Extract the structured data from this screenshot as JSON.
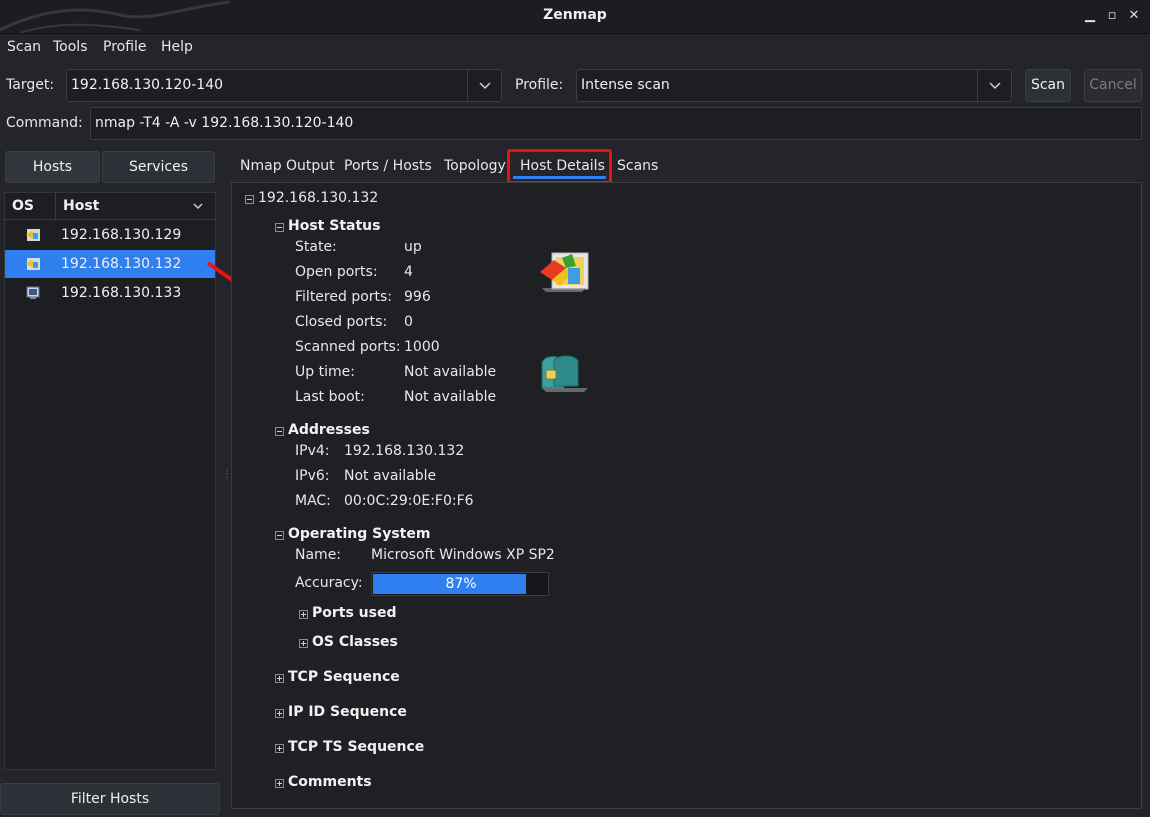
{
  "window": {
    "title": "Zenmap"
  },
  "menu": [
    "Scan",
    "Tools",
    "Profile",
    "Help"
  ],
  "toolbar": {
    "target_label": "Target:",
    "target_value": "192.168.130.120-140",
    "profile_label": "Profile:",
    "profile_value": "Intense scan",
    "scan_label": "Scan",
    "cancel_label": "Cancel",
    "command_label": "Command:",
    "command_value": "nmap -T4 -A -v 192.168.130.120-140"
  },
  "left": {
    "hosts_tab": "Hosts",
    "services_tab": "Services",
    "col_os": "OS",
    "col_host": "Host",
    "hosts": [
      "192.168.130.129",
      "192.168.130.132",
      "192.168.130.133"
    ],
    "selected_index": 1,
    "filter_label": "Filter Hosts"
  },
  "tabs": [
    "Nmap Output",
    "Ports / Hosts",
    "Topology",
    "Host Details",
    "Scans"
  ],
  "active_tab": "Host Details",
  "details": {
    "host": "192.168.130.132",
    "host_status": {
      "heading": "Host Status",
      "rows": [
        {
          "k": "State:",
          "v": "up"
        },
        {
          "k": "Open ports:",
          "v": "4"
        },
        {
          "k": "Filtered ports:",
          "v": "996"
        },
        {
          "k": "Closed ports:",
          "v": "0"
        },
        {
          "k": "Scanned ports:",
          "v": "1000"
        },
        {
          "k": "Up time:",
          "v": "Not available"
        },
        {
          "k": "Last boot:",
          "v": "Not available"
        }
      ]
    },
    "addresses": {
      "heading": "Addresses",
      "rows": [
        {
          "k": "IPv4:",
          "v": "192.168.130.132"
        },
        {
          "k": "IPv6:",
          "v": "Not available"
        },
        {
          "k": "MAC:",
          "v": "00:0C:29:0E:F0:F6"
        }
      ]
    },
    "os": {
      "heading": "Operating System",
      "name_label": "Name:",
      "name_value": "Microsoft Windows XP SP2",
      "accuracy_label": "Accuracy:",
      "accuracy_text": "87%",
      "accuracy_fraction": 0.87,
      "ports_used": "Ports used",
      "os_classes": "OS Classes"
    },
    "collapsed": [
      "TCP Sequence",
      "IP ID Sequence",
      "TCP TS Sequence",
      "Comments"
    ]
  },
  "colors": {
    "accent": "#2f7ff0",
    "highlight": "#ee1111",
    "arrow": "#ee1111"
  },
  "icons": [
    "windows-os-icon",
    "treasure-chest-icon",
    "chevron-down-icon"
  ]
}
